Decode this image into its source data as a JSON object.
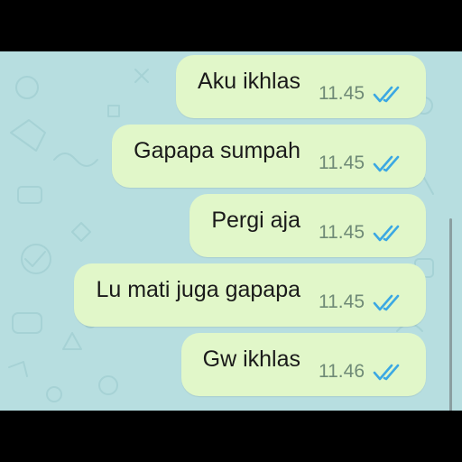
{
  "theme": {
    "wallpaper_color": "#b7dee0",
    "bubble_color": "#e1f7c9",
    "check_color": "#3ba8e3",
    "time_color": "#6f8a76"
  },
  "messages": [
    {
      "text": "Aku ikhlas",
      "time": "11.45",
      "status_icon": "double-check-read-icon"
    },
    {
      "text": "Gapapa sumpah",
      "time": "11.45",
      "status_icon": "double-check-read-icon"
    },
    {
      "text": "Pergi aja",
      "time": "11.45",
      "status_icon": "double-check-read-icon"
    },
    {
      "text": "Lu mati juga gapapa",
      "time": "11.45",
      "status_icon": "double-check-read-icon"
    },
    {
      "text": "Gw ikhlas",
      "time": "11.46",
      "status_icon": "double-check-read-icon"
    }
  ]
}
